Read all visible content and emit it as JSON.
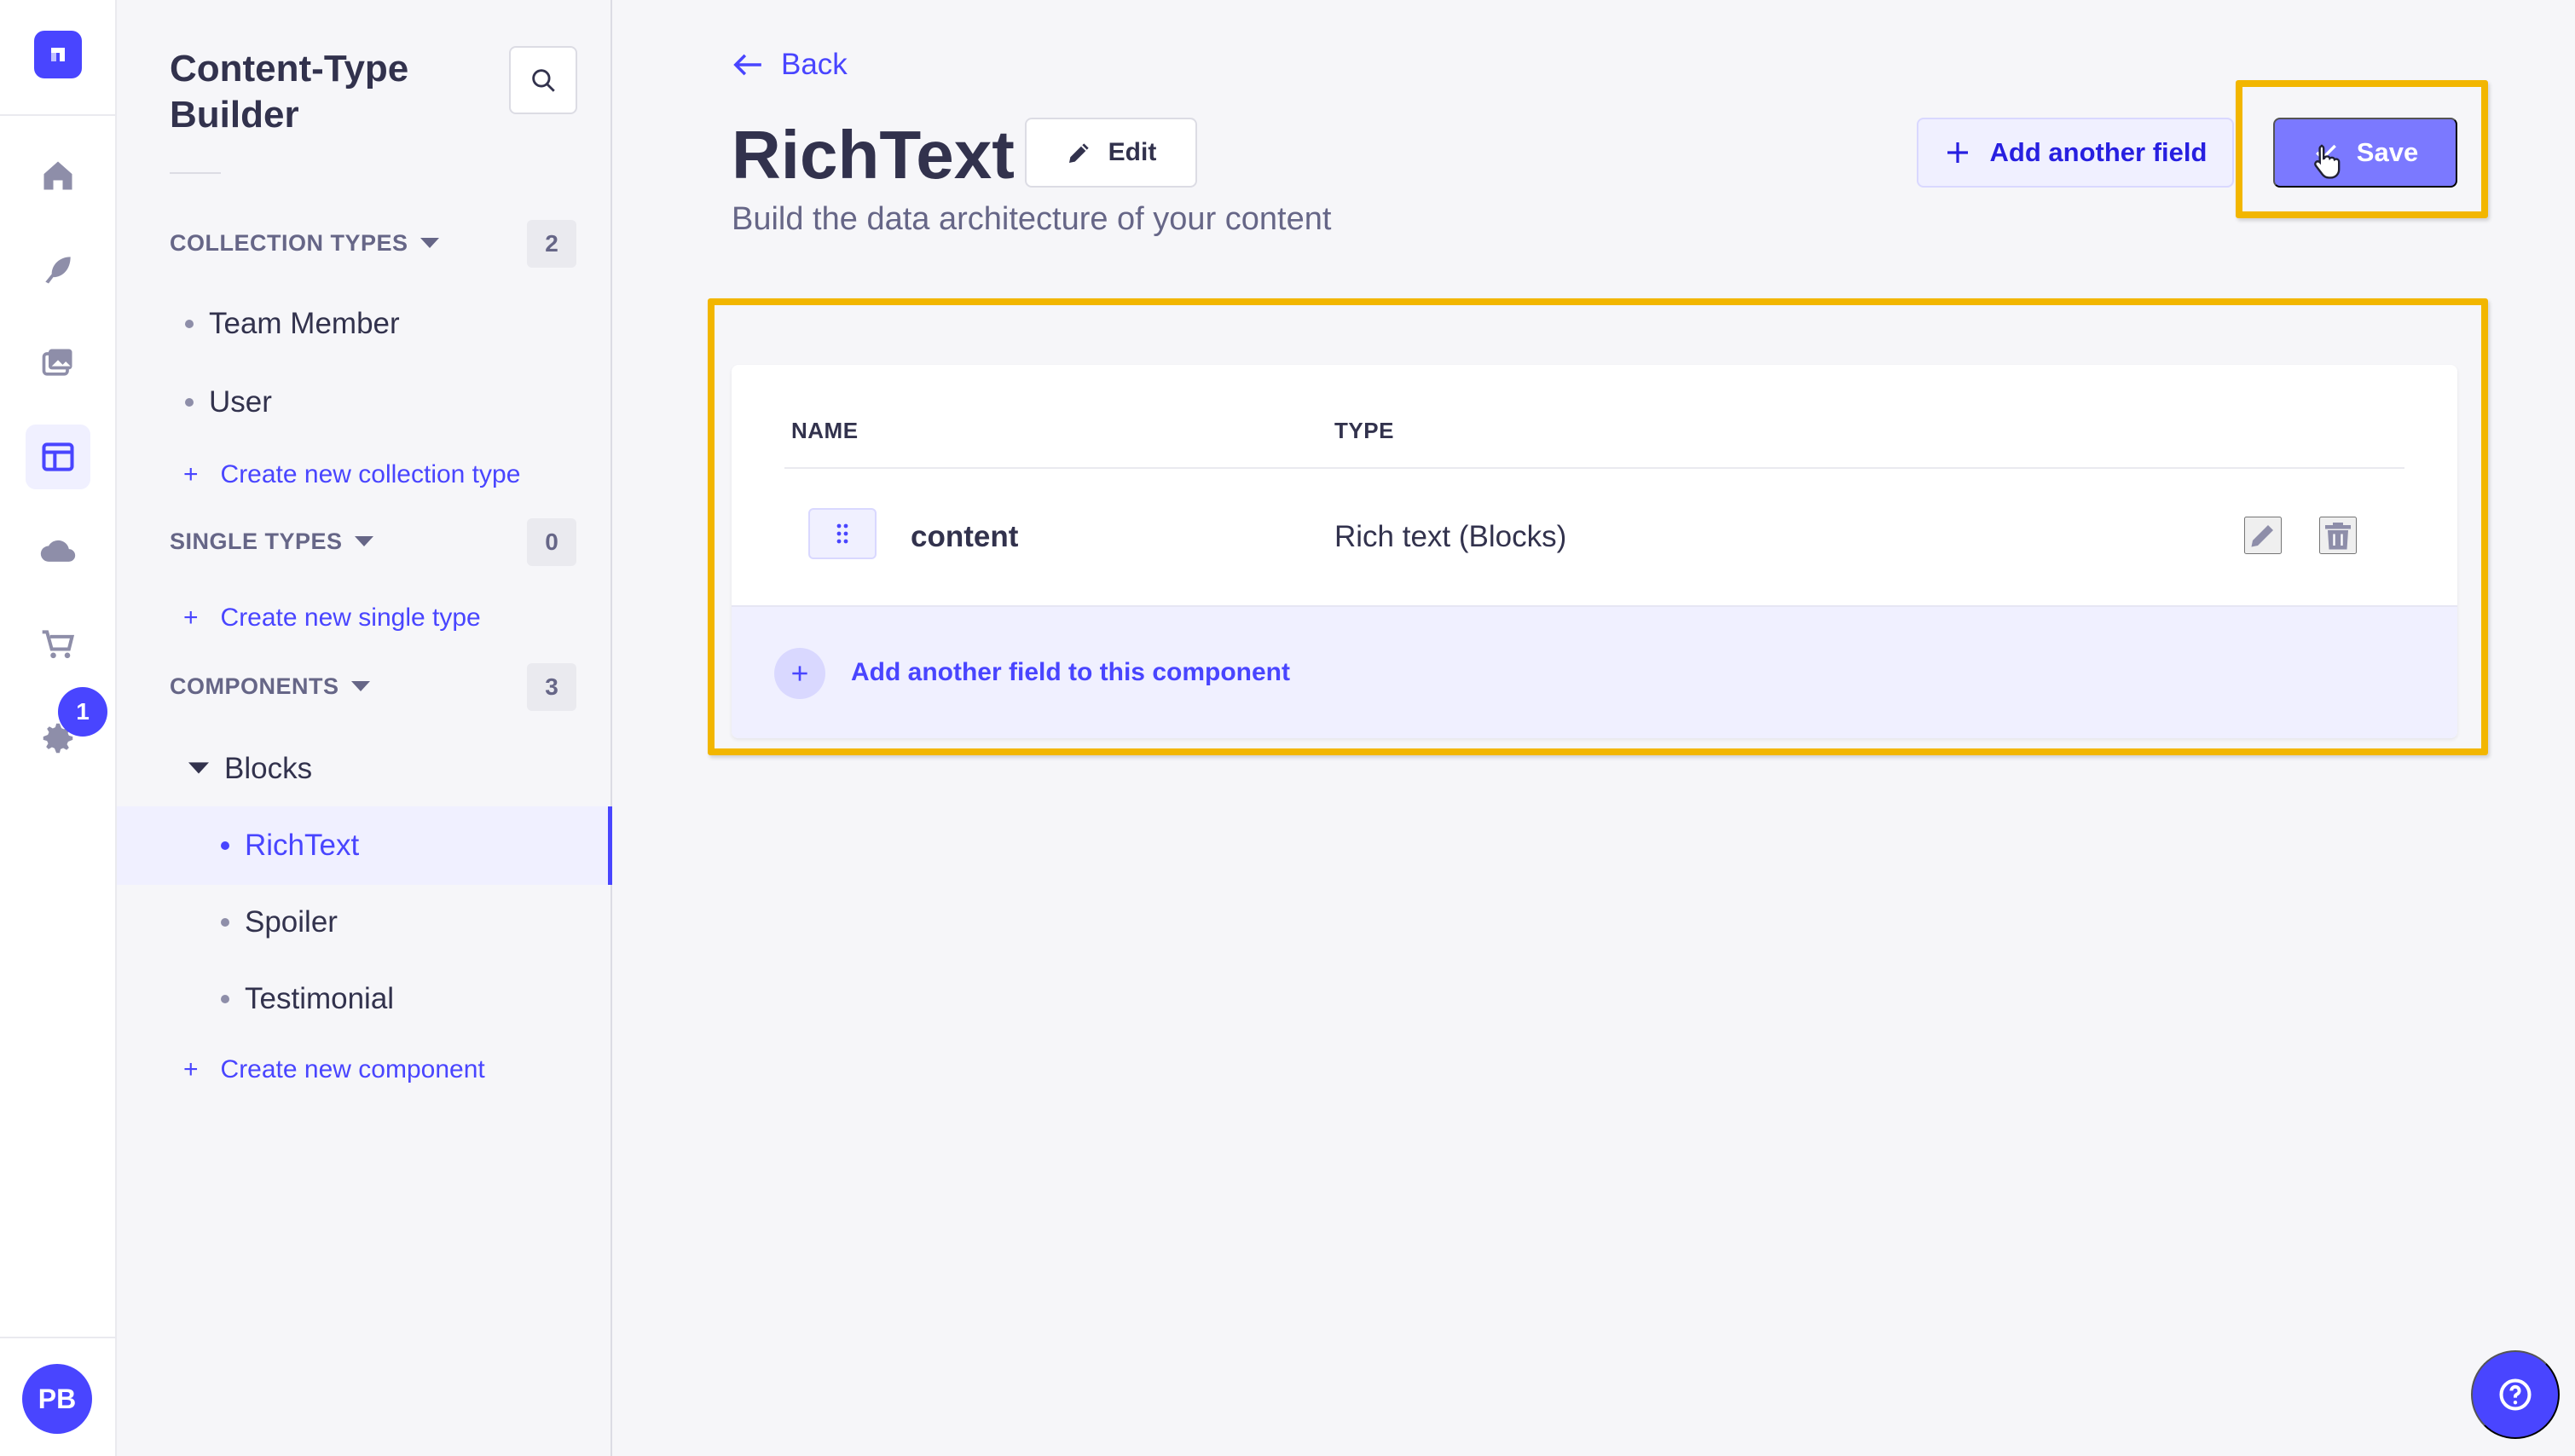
{
  "rail": {
    "badge_count": "1",
    "avatar_initials": "PB"
  },
  "subnav": {
    "title": "Content-Type Builder",
    "collection_types": {
      "label": "COLLECTION TYPES",
      "count": "2",
      "items": [
        "Team Member",
        "User"
      ],
      "create_label": "Create new collection type"
    },
    "single_types": {
      "label": "SINGLE TYPES",
      "count": "0",
      "create_label": "Create new single type"
    },
    "components": {
      "label": "COMPONENTS",
      "count": "3",
      "group": "Blocks",
      "items": [
        "RichText",
        "Spoiler",
        "Testimonial"
      ],
      "active_item": "RichText",
      "create_label": "Create new component"
    }
  },
  "header": {
    "back_label": "Back",
    "title": "RichText",
    "edit_label": "Edit",
    "subtitle": "Build the data architecture of your content",
    "add_field_label": "Add another field",
    "save_label": "Save"
  },
  "table": {
    "columns": [
      "NAME",
      "TYPE"
    ],
    "rows": [
      {
        "name": "content",
        "type": "Rich text (Blocks)"
      }
    ],
    "add_component_field_label": "Add another field to this component"
  },
  "colors": {
    "primary": "#4945ff",
    "highlight": "#f2b600",
    "save_disabled": "#7b79ff"
  }
}
